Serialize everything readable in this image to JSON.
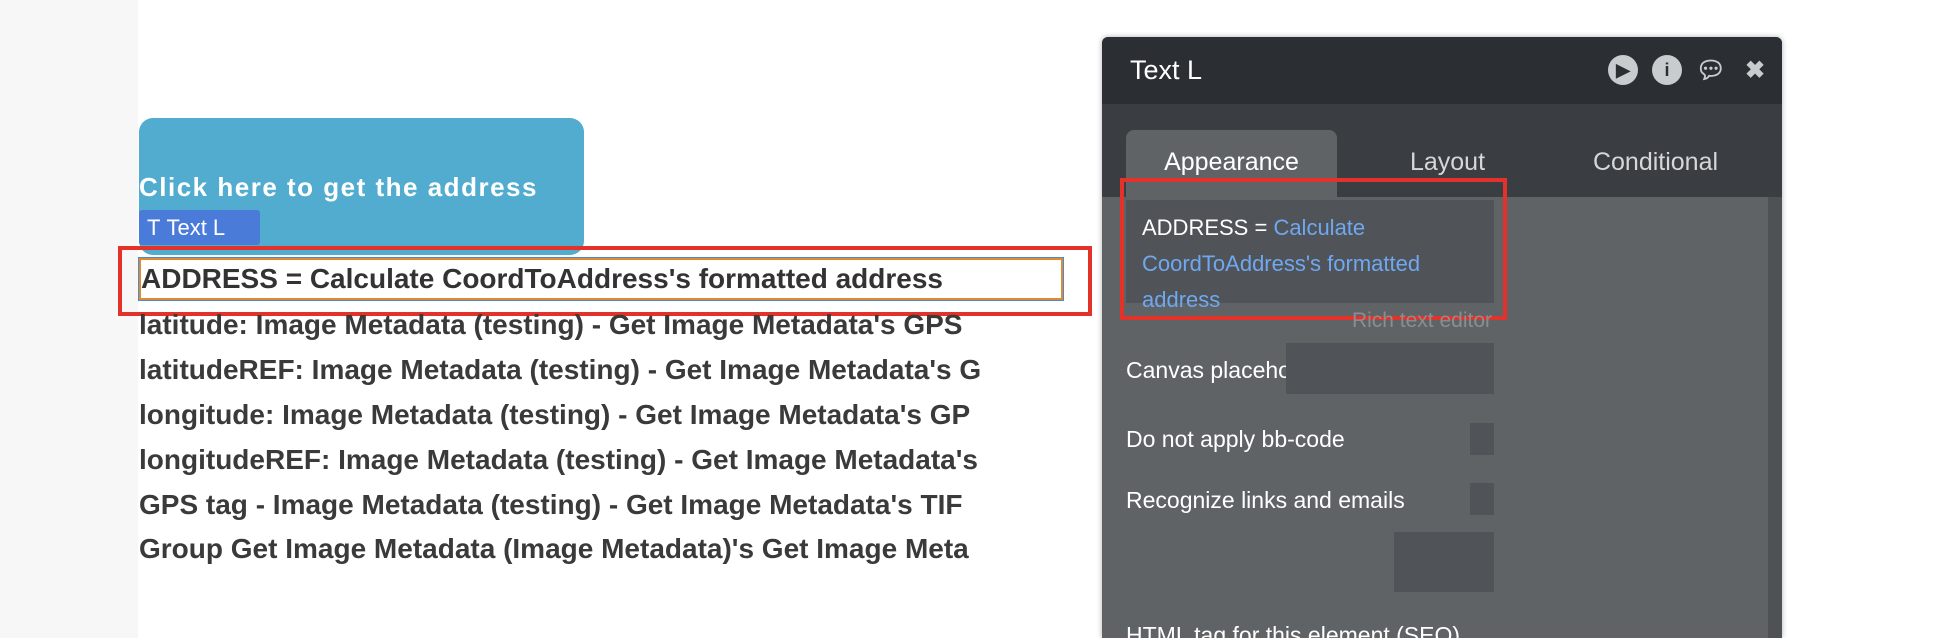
{
  "canvas": {
    "button_label": "Click here to get the address",
    "selected_badge": "Text L",
    "address_text": "ADDRESS = Calculate CoordToAddress's formatted address",
    "lines": [
      "latitude: Image Metadata (testing) - Get Image Metadata's GPS",
      "latitudeREF: Image Metadata (testing) - Get Image Metadata's G",
      "longitude: Image Metadata (testing) - Get Image Metadata's GP",
      "longitudeREF: Image Metadata (testing) - Get Image Metadata's",
      "GPS tag - Image Metadata (testing) - Get Image Metadata's TIF",
      "Group Get Image Metadata (Image Metadata)'s Get Image Meta"
    ]
  },
  "panel": {
    "title": "Text L",
    "tabs": [
      "Appearance",
      "Layout",
      "Conditional"
    ],
    "active_tab": "Appearance",
    "content_static": "ADDRESS = ",
    "content_dynamic": "Calculate CoordToAddress's formatted address",
    "rich_text_editor": "Rich text editor",
    "canvas_placeholder_label": "Canvas placeholder",
    "canvas_placeholder_value": "",
    "bbcode_label": "Do not apply bb-code",
    "links_label": "Recognize links and emails",
    "html_tag_label": "HTML tag for this element (SEO)"
  },
  "colors": {
    "button": "#52acd0",
    "badge": "#4a7bd9",
    "highlight": "#e2322a",
    "dynamic_text": "#6fa8f0"
  }
}
